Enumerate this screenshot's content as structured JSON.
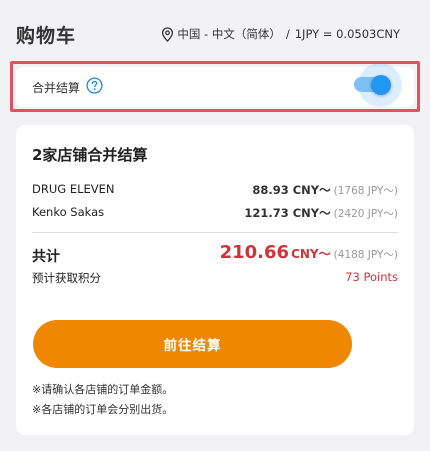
{
  "header": {
    "title": "购物车",
    "locale": "中国 - 中文（简体）",
    "separator": "/",
    "exchange_rate": "1JPY = 0.0503CNY"
  },
  "merge": {
    "label": "合并结算",
    "help_icon": "question-circle-icon",
    "toggle_on": true
  },
  "summary": {
    "title": "2家店铺合并结算",
    "shops": [
      {
        "name": "DRUG ELEVEN",
        "amount_cny": "88.93 CNY～",
        "amount_jpy": "(1768 JPY～)"
      },
      {
        "name": "Kenko Sakas",
        "amount_cny": "121.73 CNY～",
        "amount_jpy": "(2420 JPY～)"
      }
    ],
    "total_label": "共计",
    "total_value": "210.66",
    "total_unit": "CNY～",
    "total_jpy": "(4188 JPY～)",
    "points_label": "预计获取积分",
    "points_value": "73 Points"
  },
  "checkout_label": "前往结算",
  "notes": [
    "※请确认各店铺的订单金额。",
    "※各店铺的订单会分别出货。"
  ],
  "colors": {
    "accent_blue": "#2196f3",
    "price_red": "#d0343a",
    "checkout_orange": "#ef8700",
    "highlight_red": "#e0525e"
  }
}
